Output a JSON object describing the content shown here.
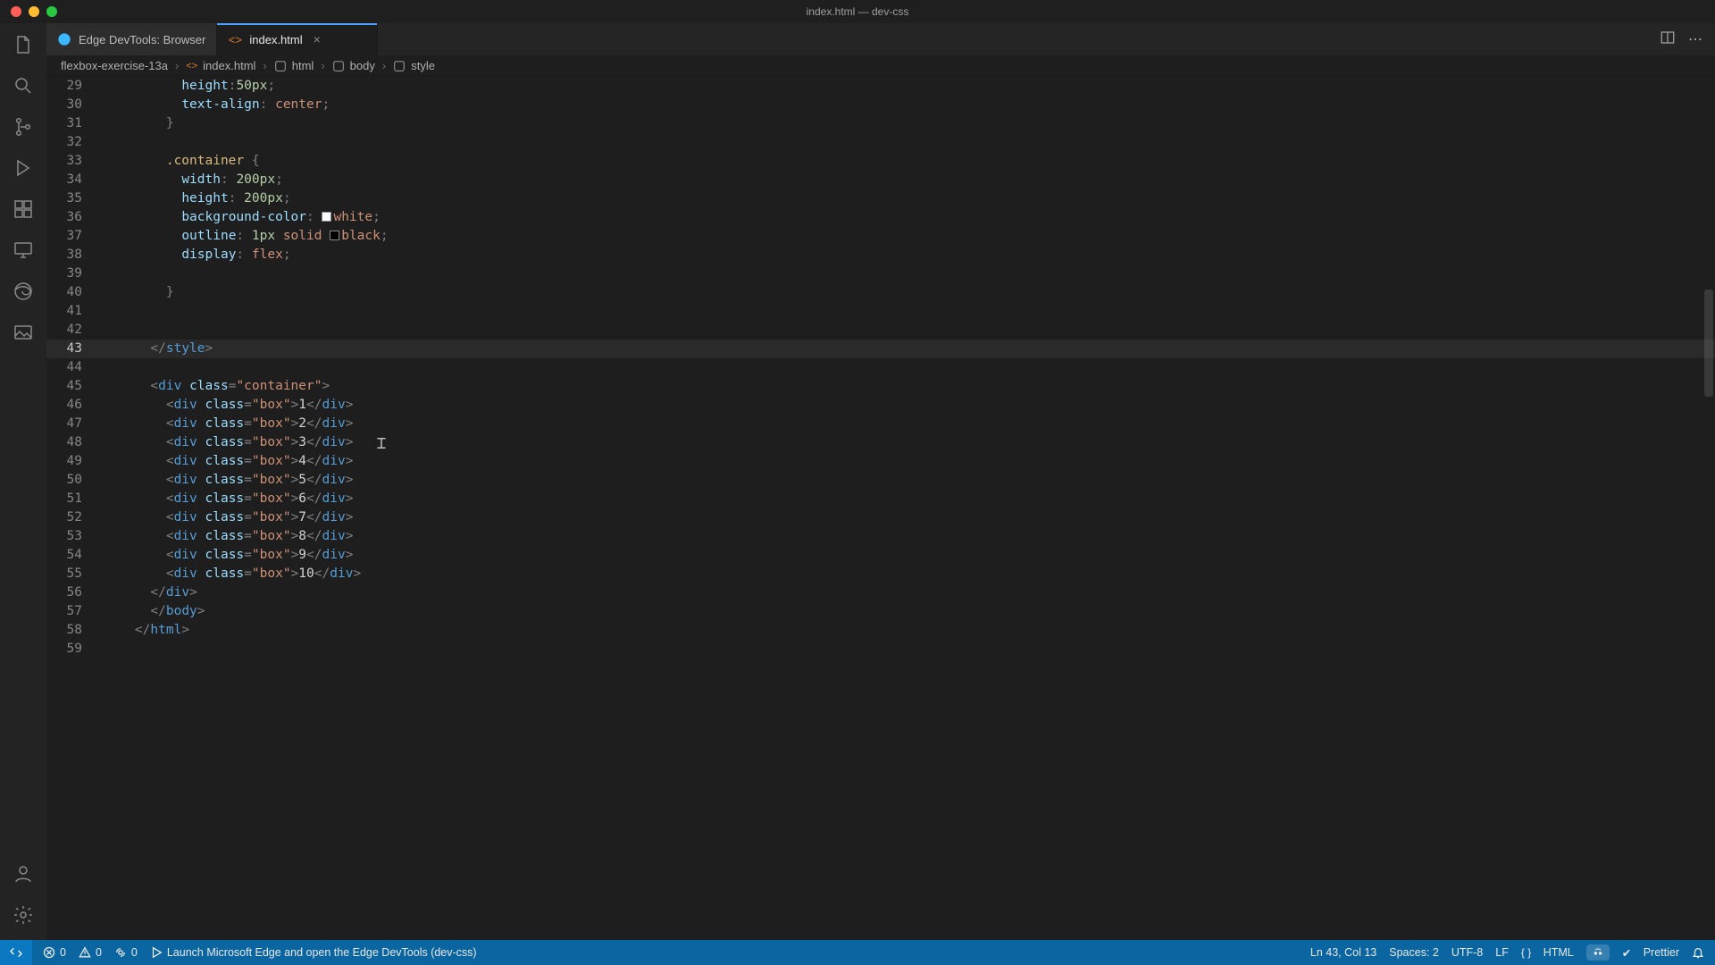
{
  "titlebar": {
    "title": "index.html — dev-css"
  },
  "tabs": [
    {
      "label": "Edge DevTools: Browser",
      "icon": "edge"
    },
    {
      "label": "index.html",
      "icon": "html",
      "active": true
    }
  ],
  "breadcrumbs": [
    {
      "label": "flexbox-exercise-13a",
      "icon": "folder"
    },
    {
      "label": "index.html",
      "icon": "file-html"
    },
    {
      "label": "html",
      "icon": "symbol"
    },
    {
      "label": "body",
      "icon": "symbol"
    },
    {
      "label": "style",
      "icon": "symbol"
    }
  ],
  "editor": {
    "first_line": 29,
    "active_line": 43,
    "lines": [
      {
        "n": 29,
        "indent": 3,
        "tokens": [
          [
            "a",
            "height"
          ],
          [
            "p",
            ":"
          ],
          [
            "n",
            "50px"
          ],
          [
            "p",
            ";"
          ]
        ]
      },
      {
        "n": 30,
        "indent": 3,
        "tokens": [
          [
            "a",
            "text-align"
          ],
          [
            "p",
            ": "
          ],
          [
            "v",
            "center"
          ],
          [
            "p",
            ";"
          ]
        ]
      },
      {
        "n": 31,
        "indent": 2,
        "tokens": [
          [
            "p",
            "}"
          ]
        ]
      },
      {
        "n": 32,
        "indent": 2,
        "tokens": []
      },
      {
        "n": 33,
        "indent": 2,
        "tokens": [
          [
            "sel",
            ".container"
          ],
          [
            "c",
            " "
          ],
          [
            "p",
            "{"
          ]
        ]
      },
      {
        "n": 34,
        "indent": 3,
        "tokens": [
          [
            "a",
            "width"
          ],
          [
            "p",
            ": "
          ],
          [
            "n",
            "200px"
          ],
          [
            "p",
            ";"
          ]
        ]
      },
      {
        "n": 35,
        "indent": 3,
        "tokens": [
          [
            "a",
            "height"
          ],
          [
            "p",
            ": "
          ],
          [
            "n",
            "200px"
          ],
          [
            "p",
            ";"
          ]
        ]
      },
      {
        "n": 36,
        "indent": 3,
        "tokens": [
          [
            "a",
            "background-color"
          ],
          [
            "p",
            ": "
          ],
          [
            "swatch",
            "#ffffff"
          ],
          [
            "v",
            "white"
          ],
          [
            "p",
            ";"
          ]
        ]
      },
      {
        "n": 37,
        "indent": 3,
        "tokens": [
          [
            "a",
            "outline"
          ],
          [
            "p",
            ": "
          ],
          [
            "n",
            "1px"
          ],
          [
            "c",
            " "
          ],
          [
            "v",
            "solid"
          ],
          [
            "c",
            " "
          ],
          [
            "swatch",
            "#000000"
          ],
          [
            "v",
            "black"
          ],
          [
            "p",
            ";"
          ]
        ]
      },
      {
        "n": 38,
        "indent": 3,
        "tokens": [
          [
            "a",
            "display"
          ],
          [
            "p",
            ": "
          ],
          [
            "v",
            "flex"
          ],
          [
            "p",
            ";"
          ]
        ]
      },
      {
        "n": 39,
        "indent": 3,
        "tokens": []
      },
      {
        "n": 40,
        "indent": 2,
        "tokens": [
          [
            "p",
            "}"
          ]
        ]
      },
      {
        "n": 41,
        "indent": 1,
        "tokens": []
      },
      {
        "n": 42,
        "indent": 1,
        "tokens": []
      },
      {
        "n": 43,
        "indent": 1,
        "tokens": [
          [
            "p",
            "</"
          ],
          [
            "t",
            "style"
          ],
          [
            "p",
            ">"
          ]
        ]
      },
      {
        "n": 44,
        "indent": 1,
        "tokens": []
      },
      {
        "n": 45,
        "indent": 1,
        "tokens": [
          [
            "p",
            "<"
          ],
          [
            "t",
            "div"
          ],
          [
            "c",
            " "
          ],
          [
            "a",
            "class"
          ],
          [
            "p",
            "="
          ],
          [
            "s",
            "\"container\""
          ],
          [
            "p",
            ">"
          ]
        ]
      },
      {
        "n": 46,
        "indent": 2,
        "tokens": [
          [
            "p",
            "<"
          ],
          [
            "t",
            "div"
          ],
          [
            "c",
            " "
          ],
          [
            "a",
            "class"
          ],
          [
            "p",
            "="
          ],
          [
            "s",
            "\"box\""
          ],
          [
            "p",
            ">"
          ],
          [
            "c",
            "1"
          ],
          [
            "p",
            "</"
          ],
          [
            "t",
            "div"
          ],
          [
            "p",
            ">"
          ]
        ]
      },
      {
        "n": 47,
        "indent": 2,
        "tokens": [
          [
            "p",
            "<"
          ],
          [
            "t",
            "div"
          ],
          [
            "c",
            " "
          ],
          [
            "a",
            "class"
          ],
          [
            "p",
            "="
          ],
          [
            "s",
            "\"box\""
          ],
          [
            "p",
            ">"
          ],
          [
            "c",
            "2"
          ],
          [
            "p",
            "</"
          ],
          [
            "t",
            "div"
          ],
          [
            "p",
            ">"
          ]
        ]
      },
      {
        "n": 48,
        "indent": 2,
        "tokens": [
          [
            "p",
            "<"
          ],
          [
            "t",
            "div"
          ],
          [
            "c",
            " "
          ],
          [
            "a",
            "class"
          ],
          [
            "p",
            "="
          ],
          [
            "s",
            "\"box\""
          ],
          [
            "p",
            ">"
          ],
          [
            "c",
            "3"
          ],
          [
            "p",
            "</"
          ],
          [
            "t",
            "div"
          ],
          [
            "p",
            ">"
          ]
        ]
      },
      {
        "n": 49,
        "indent": 2,
        "tokens": [
          [
            "p",
            "<"
          ],
          [
            "t",
            "div"
          ],
          [
            "c",
            " "
          ],
          [
            "a",
            "class"
          ],
          [
            "p",
            "="
          ],
          [
            "s",
            "\"box\""
          ],
          [
            "p",
            ">"
          ],
          [
            "c",
            "4"
          ],
          [
            "p",
            "</"
          ],
          [
            "t",
            "div"
          ],
          [
            "p",
            ">"
          ]
        ]
      },
      {
        "n": 50,
        "indent": 2,
        "tokens": [
          [
            "p",
            "<"
          ],
          [
            "t",
            "div"
          ],
          [
            "c",
            " "
          ],
          [
            "a",
            "class"
          ],
          [
            "p",
            "="
          ],
          [
            "s",
            "\"box\""
          ],
          [
            "p",
            ">"
          ],
          [
            "c",
            "5"
          ],
          [
            "p",
            "</"
          ],
          [
            "t",
            "div"
          ],
          [
            "p",
            ">"
          ]
        ]
      },
      {
        "n": 51,
        "indent": 2,
        "tokens": [
          [
            "p",
            "<"
          ],
          [
            "t",
            "div"
          ],
          [
            "c",
            " "
          ],
          [
            "a",
            "class"
          ],
          [
            "p",
            "="
          ],
          [
            "s",
            "\"box\""
          ],
          [
            "p",
            ">"
          ],
          [
            "c",
            "6"
          ],
          [
            "p",
            "</"
          ],
          [
            "t",
            "div"
          ],
          [
            "p",
            ">"
          ]
        ]
      },
      {
        "n": 52,
        "indent": 2,
        "tokens": [
          [
            "p",
            "<"
          ],
          [
            "t",
            "div"
          ],
          [
            "c",
            " "
          ],
          [
            "a",
            "class"
          ],
          [
            "p",
            "="
          ],
          [
            "s",
            "\"box\""
          ],
          [
            "p",
            ">"
          ],
          [
            "c",
            "7"
          ],
          [
            "p",
            "</"
          ],
          [
            "t",
            "div"
          ],
          [
            "p",
            ">"
          ]
        ]
      },
      {
        "n": 53,
        "indent": 2,
        "tokens": [
          [
            "p",
            "<"
          ],
          [
            "t",
            "div"
          ],
          [
            "c",
            " "
          ],
          [
            "a",
            "class"
          ],
          [
            "p",
            "="
          ],
          [
            "s",
            "\"box\""
          ],
          [
            "p",
            ">"
          ],
          [
            "c",
            "8"
          ],
          [
            "p",
            "</"
          ],
          [
            "t",
            "div"
          ],
          [
            "p",
            ">"
          ]
        ]
      },
      {
        "n": 54,
        "indent": 2,
        "tokens": [
          [
            "p",
            "<"
          ],
          [
            "t",
            "div"
          ],
          [
            "c",
            " "
          ],
          [
            "a",
            "class"
          ],
          [
            "p",
            "="
          ],
          [
            "s",
            "\"box\""
          ],
          [
            "p",
            ">"
          ],
          [
            "c",
            "9"
          ],
          [
            "p",
            "</"
          ],
          [
            "t",
            "div"
          ],
          [
            "p",
            ">"
          ]
        ]
      },
      {
        "n": 55,
        "indent": 2,
        "tokens": [
          [
            "p",
            "<"
          ],
          [
            "t",
            "div"
          ],
          [
            "c",
            " "
          ],
          [
            "a",
            "class"
          ],
          [
            "p",
            "="
          ],
          [
            "s",
            "\"box\""
          ],
          [
            "p",
            ">"
          ],
          [
            "c",
            "10"
          ],
          [
            "p",
            "</"
          ],
          [
            "t",
            "div"
          ],
          [
            "p",
            ">"
          ]
        ]
      },
      {
        "n": 56,
        "indent": 1,
        "tokens": [
          [
            "p",
            "</"
          ],
          [
            "t",
            "div"
          ],
          [
            "p",
            ">"
          ]
        ]
      },
      {
        "n": 57,
        "indent": 1,
        "tokens": [
          [
            "p",
            "</"
          ],
          [
            "t",
            "body"
          ],
          [
            "p",
            ">"
          ]
        ],
        "indent_override": 0,
        "lead_spaces": 2
      },
      {
        "n": 58,
        "indent": 0,
        "tokens": [
          [
            "p",
            "</"
          ],
          [
            "t",
            "html"
          ],
          [
            "p",
            ">"
          ]
        ]
      },
      {
        "n": 59,
        "indent": 0,
        "tokens": []
      }
    ]
  },
  "status": {
    "errors": "0",
    "warnings": "0",
    "ports": "0",
    "launch": "Launch Microsoft Edge and open the Edge DevTools (dev-css)",
    "cursor": "Ln 43, Col 13",
    "spaces": "Spaces: 2",
    "encoding": "UTF-8",
    "eol": "LF",
    "language": "HTML",
    "prettier": "Prettier"
  }
}
